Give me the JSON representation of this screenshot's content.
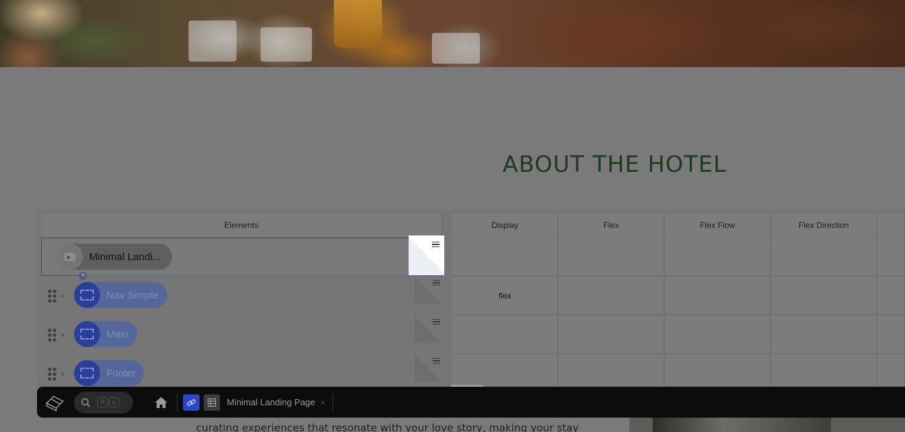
{
  "page": {
    "heading": "ABOUT THE HOTEL",
    "body_text_partial": "curating experiences that resonate with your love story, making your stay"
  },
  "table": {
    "columns": [
      "Elements",
      "Display",
      "Flex",
      "Flex Flow",
      "Flex Direction"
    ],
    "rows": [
      {
        "label": "Minimal Landi...",
        "display": "",
        "selected": true
      },
      {
        "label": "Nav Simple",
        "display": "flex"
      },
      {
        "label": "Main",
        "display": ""
      },
      {
        "label": "Footer",
        "display": ""
      }
    ]
  },
  "dock": {
    "shortcut_keys": [
      "⌘",
      "K"
    ],
    "open_tab_label": "Minimal Landing Page",
    "close_glyph": "×"
  },
  "icons": {
    "logo": "app-logo-icon",
    "search": "search-icon",
    "home": "home-icon",
    "link": "link-icon",
    "table": "table-icon"
  },
  "colors": {
    "heading": "#1d3a1f",
    "dock_bg": "#0c0c0d",
    "accent_blue": "#2a46c9",
    "component_pill": "#55679a"
  }
}
